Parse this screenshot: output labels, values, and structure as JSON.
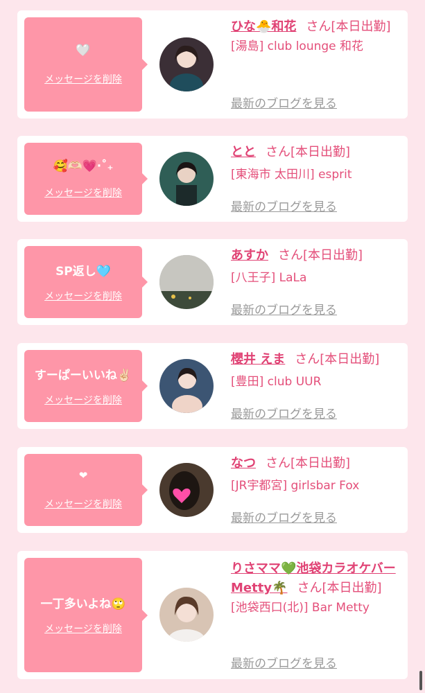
{
  "messages": [
    {
      "bubble_text": "🤍",
      "delete_label": "メッセージを削除",
      "name": "ひな🐣和花",
      "status": "さん[本日出勤]",
      "shop": "[湯島] club lounge 和花",
      "blog_link": "最新のブログを見る",
      "avatar_color": "#3b2f36"
    },
    {
      "bubble_text": "🥰🫶🏻💗‧˚₊",
      "delete_label": "メッセージを削除",
      "name": "とと",
      "status": "さん[本日出勤]",
      "shop": "[東海市 太田川] esprit",
      "blog_link": "最新のブログを見る",
      "avatar_color": "#2f5e56"
    },
    {
      "bubble_text": "SP返し🩵",
      "delete_label": "メッセージを削除",
      "name": "あすか",
      "status": "さん[本日出勤]",
      "shop": "[八王子] LaLa",
      "blog_link": "最新のブログを見る",
      "avatar_color": "#b9b9b4"
    },
    {
      "bubble_text": "すーぱーいいね✌🏻",
      "delete_label": "メッセージを削除",
      "name": "櫻井 えま",
      "status": "さん[本日出勤]",
      "shop": "[豊田] club UUR",
      "blog_link": "最新のブログを見る",
      "avatar_color": "#3c5573"
    },
    {
      "bubble_text": "❤",
      "delete_label": "メッセージを削除",
      "name": "なつ",
      "status": "さん[本日出勤]",
      "shop": "[JR宇都宮] girlsbar Fox",
      "blog_link": "最新のブログを見る",
      "avatar_color": "#4a3a2e"
    },
    {
      "bubble_text": "一丁多いよね🙄",
      "delete_label": "メッセージを削除",
      "name": "りさママ💚池袋カラオケバーMetty🌴",
      "status": "さん[本日出勤]",
      "shop": "[池袋西口(北)] Bar Metty",
      "blog_link": "最新のブログを見る",
      "avatar_color": "#d8c4b4"
    }
  ],
  "colors": {
    "background": "#fde6ec",
    "bubble": "#fe96a8",
    "accent": "#e04274",
    "link_gray": "#9a9a9a"
  }
}
